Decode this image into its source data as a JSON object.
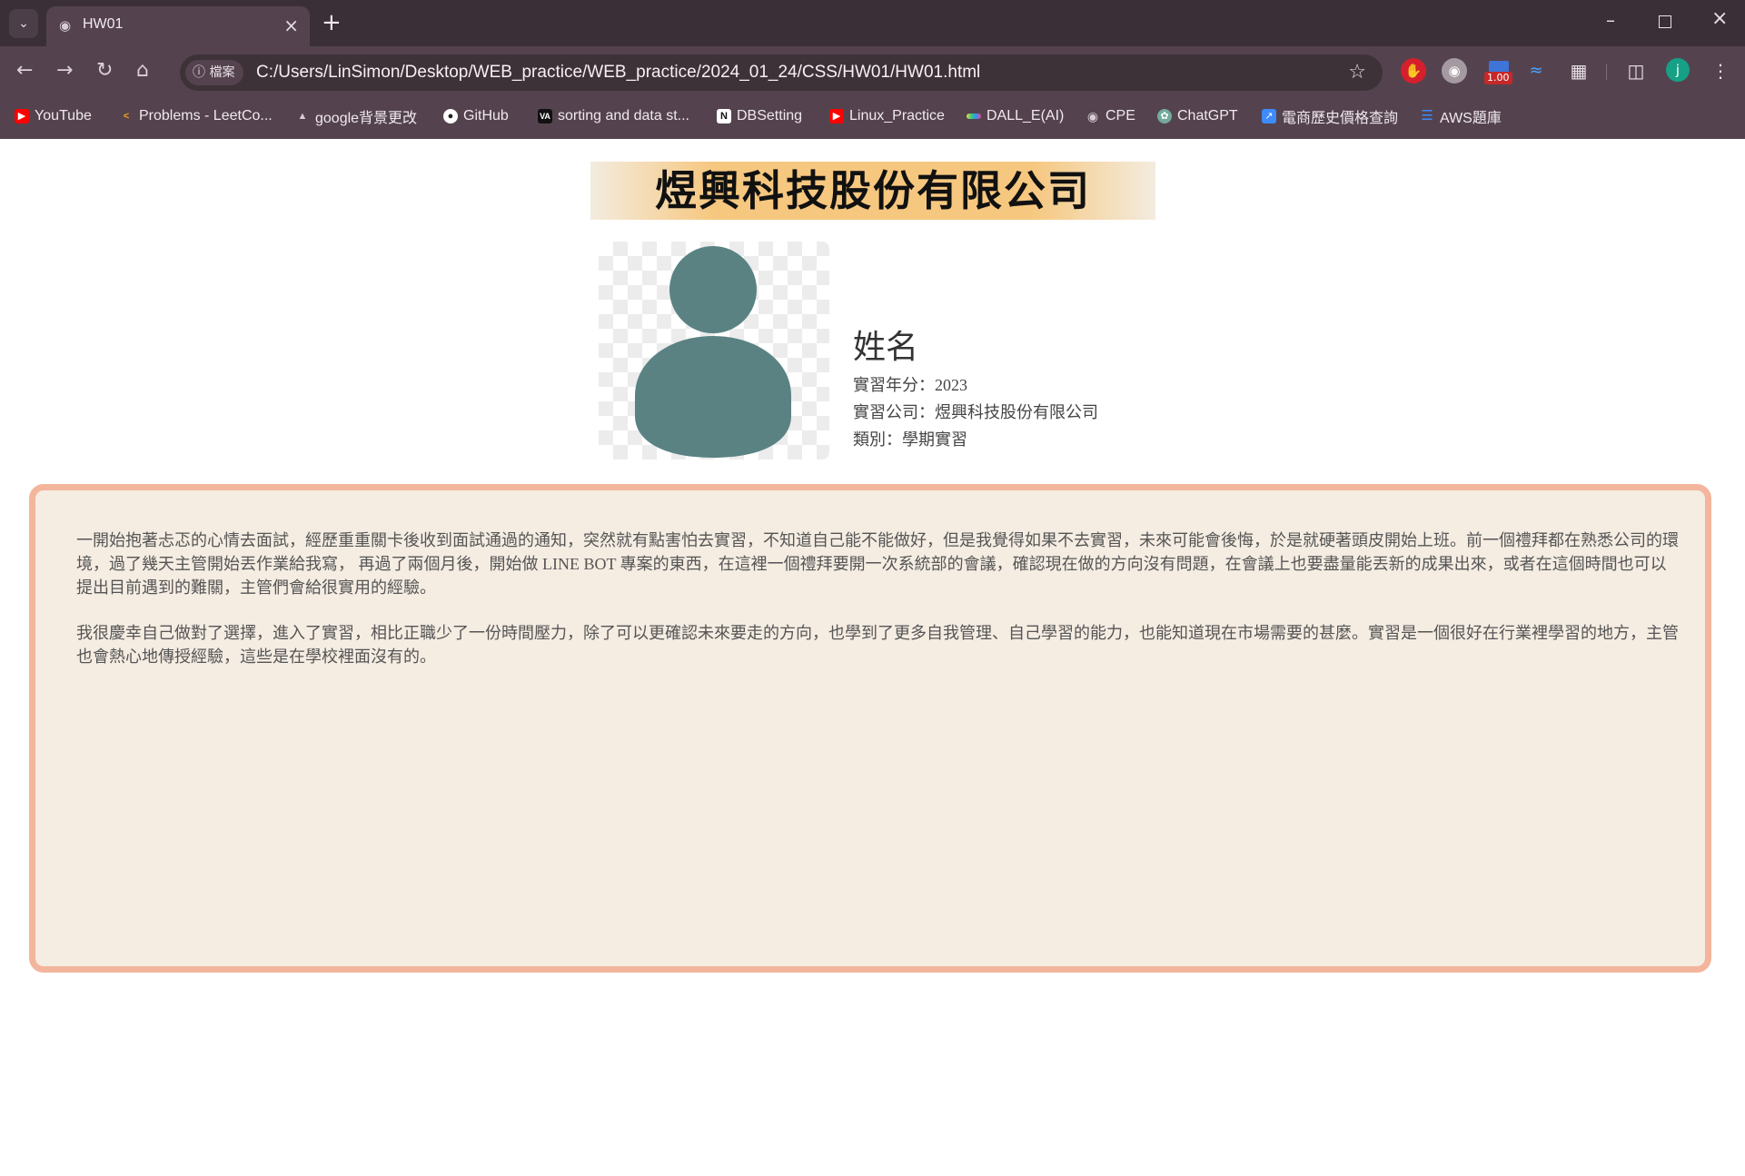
{
  "browser": {
    "tab_title": "HW01",
    "chip_label": "檔案",
    "url": "C:/Users/LinSimon/Desktop/WEB_practice/WEB_practice/2024_01_24/CSS/HW01/HW01.html",
    "extension_badge": "1.00",
    "profile_initial": "j",
    "bookmarks": [
      {
        "label": "YouTube",
        "icon": "youtube-icon",
        "color": "#ff0000"
      },
      {
        "label": "Problems - LeetCo...",
        "icon": "leetcode-icon",
        "color": "#f7a21b"
      },
      {
        "label": "google背景更改",
        "icon": "flask-icon",
        "color": "#cfc4cb"
      },
      {
        "label": "GitHub",
        "icon": "github-icon",
        "color": "#ffffff"
      },
      {
        "label": "sorting and data st...",
        "icon": "va-icon",
        "color": "#111111"
      },
      {
        "label": "DBSetting",
        "icon": "notion-icon",
        "color": "#ffffff"
      },
      {
        "label": "Linux_Practice",
        "icon": "youtube-icon",
        "color": "#ff0000"
      },
      {
        "label": "DALL_E(AI)",
        "icon": "dalle-icon",
        "color": "#f7d24b"
      },
      {
        "label": "CPE",
        "icon": "globe-icon",
        "color": "#cfc4cb"
      },
      {
        "label": "ChatGPT",
        "icon": "chatgpt-icon",
        "color": "#74aa9c"
      },
      {
        "label": "電商歷史價格查詢",
        "icon": "chart-icon",
        "color": "#3d8bfd"
      },
      {
        "label": "AWS題庫",
        "icon": "list-icon",
        "color": "#3d8bfd"
      }
    ]
  },
  "page": {
    "company_title": "煜興科技股份有限公司",
    "name": "姓名",
    "year_line": "實習年分：2023",
    "company_line": "實習公司：煜興科技股份有限公司",
    "category_line": "類別：學期實習",
    "paragraphs": [
      "一開始抱著忐忑的心情去面試，經歷重重關卡後收到面試通過的通知，突然就有點害怕去實習，不知道自己能不能做好，但是我覺得如果不去實習，未來可能會後悔，於是就硬著頭皮開始上班。前一個禮拜都在熟悉公司的環境，過了幾天主管開始丟作業給我寫， 再過了兩個月後，開始做 LINE BOT 專案的東西，在這裡一個禮拜要開一次系統部的會議，確認現在做的方向沒有問題，在會議上也要盡量能丟新的成果出來，或者在這個時間也可以提出目前遇到的難關，主管們會給很實用的經驗。",
      "我很慶幸自己做對了選擇，進入了實習，相比正職少了一份時間壓力，除了可以更確認未來要走的方向，也學到了更多自我管理、自己學習的能力，也能知道現在市場需要的甚麼。實習是一個很好在行業裡學習的地方，主管也會熱心地傳授經驗，這些是在學校裡面沒有的。"
    ],
    "avatar_color": "#5a8283",
    "card_border_color": "#f3b59c",
    "card_bg_color": "#f5ece2"
  }
}
